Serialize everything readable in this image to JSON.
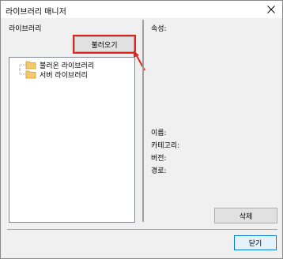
{
  "window": {
    "title": "라이브러리 매니저",
    "close_icon": "close-icon"
  },
  "left": {
    "label": "라이브러리",
    "load_button": "불러오기",
    "tree_items": [
      {
        "label": "불러온 라이브러리",
        "icon": "folder-icon"
      },
      {
        "label": "서버 라이브러리",
        "icon": "folder-icon"
      }
    ]
  },
  "right": {
    "attributes_label": "속성:",
    "name_label": "이름:",
    "category_label": "카테고리:",
    "version_label": "버전:",
    "path_label": "경로:",
    "delete_button": "삭제"
  },
  "footer": {
    "close_button": "닫기"
  },
  "colors": {
    "highlight": "#e0251b",
    "folder": "#f3c96a",
    "focus_border": "#0078d7"
  }
}
